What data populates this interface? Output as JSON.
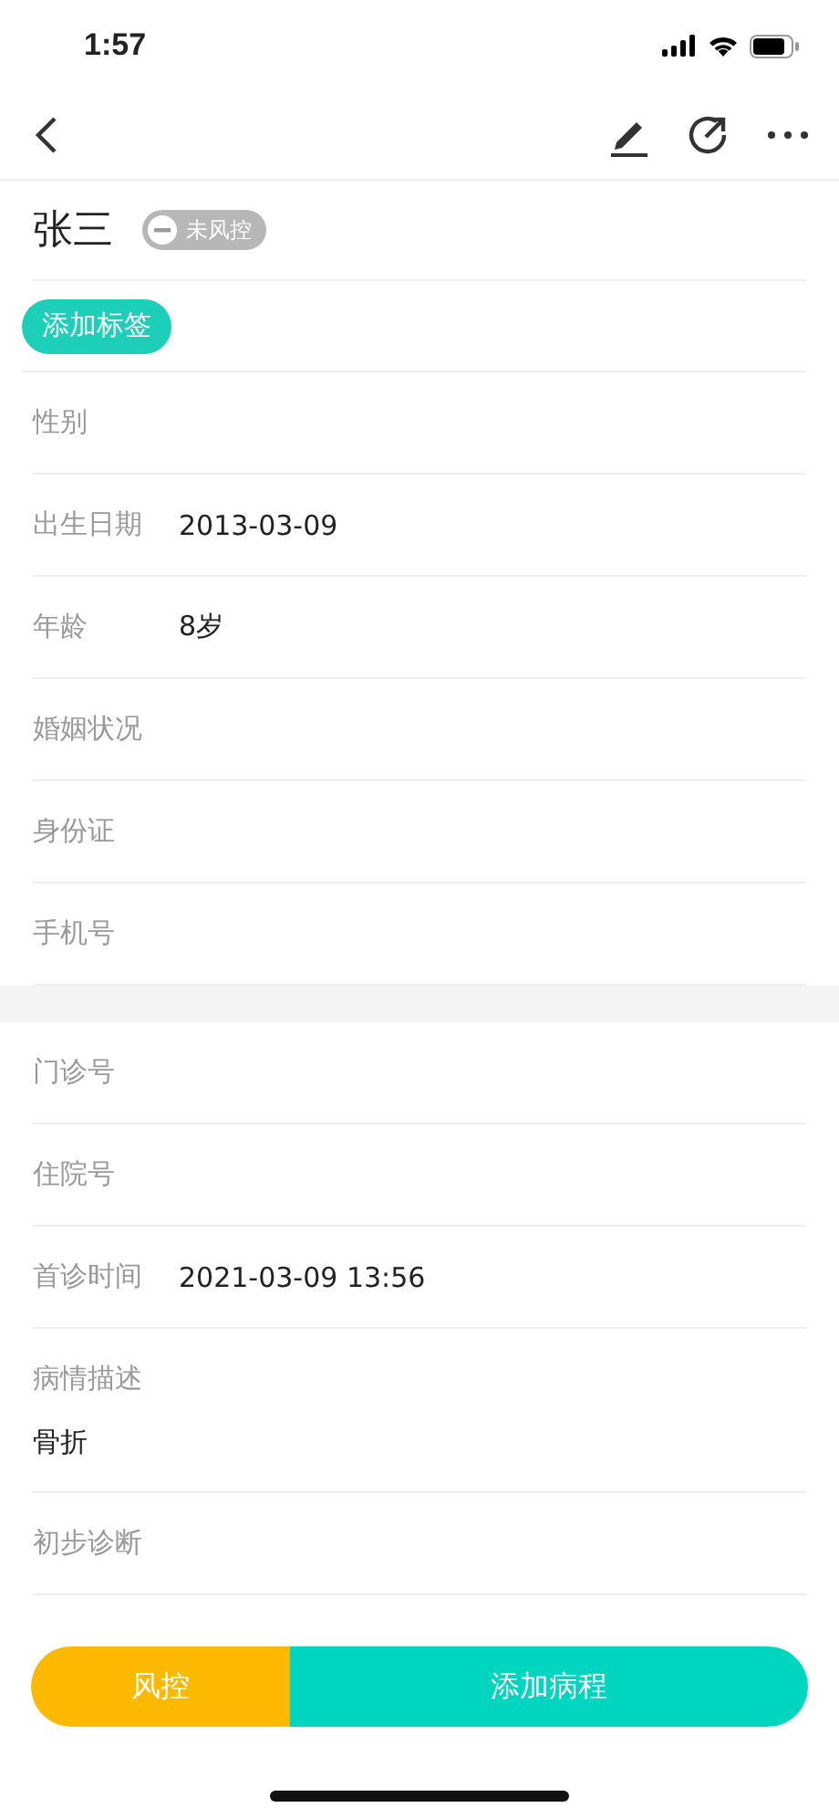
{
  "status_bar": {
    "time": "1:57"
  },
  "patient": {
    "name": "张三",
    "risk_badge": "未风控"
  },
  "tag_button": "添加标签",
  "sections": [
    {
      "rows": [
        {
          "kind": "inline",
          "label": "性别"
        },
        {
          "kind": "inline",
          "label": "出生日期",
          "value": "2013-03-09"
        },
        {
          "kind": "inline",
          "label": "年龄",
          "value": "8岁"
        },
        {
          "kind": "inline",
          "label": "婚姻状况"
        },
        {
          "kind": "inline",
          "label": "身份证"
        },
        {
          "kind": "inline",
          "label": "手机号"
        }
      ]
    },
    {
      "rows": [
        {
          "kind": "inline",
          "label": "门诊号"
        },
        {
          "kind": "inline",
          "label": "住院号"
        },
        {
          "kind": "inline",
          "label": "首诊时间",
          "value": "2021-03-09 13:56"
        },
        {
          "kind": "stacked",
          "label": "病情描述",
          "value": "骨折"
        },
        {
          "kind": "inline",
          "label": "初步诊断"
        }
      ]
    }
  ],
  "bottom_actions": [
    {
      "kind": "risk",
      "label": "风控"
    },
    {
      "kind": "primary",
      "label": "添加病程"
    }
  ]
}
